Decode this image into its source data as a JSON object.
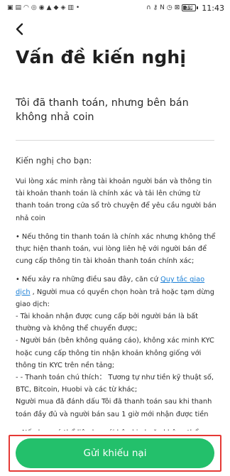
{
  "status_bar": {
    "left_icons": [
      "notification-icon",
      "image-icon",
      "wifi-icon",
      "sync-icon",
      "app-icon",
      "location-icon",
      "bell-icon",
      "app-icon",
      "translate-icon",
      "more-icon"
    ],
    "right_icons": [
      "headphones-icon",
      "key-icon",
      "nfc-icon",
      "alarm-icon",
      "no-sim-icon"
    ],
    "battery": "39",
    "time": "11:43"
  },
  "header": {
    "title": "Vấn đề kiến nghị"
  },
  "case": {
    "title": "Tôi đã thanh toán, nhưng bên bán không nhả coin"
  },
  "suggestion": {
    "heading": "Kiến nghị cho bạn:",
    "p1": "Vui lòng xác minh rằng tài khoản người bán và thông tin tài khoản thanh toán là chính xác và tải lên chứng từ thanh toán trong cửa sổ trò chuyện để yêu cầu người bán nhả coin",
    "p2": "• Nếu thông tin thanh toán là chính xác nhưng không thể thực hiện thanh toán, vui lòng liên hệ với người bán để cung cấp thông tin tài khoản thanh toán chính xác;",
    "p3_before": "• Nếu xảy ra những điều sau đây, căn cứ ",
    "p3_link": "Quy tắc giao dịch",
    "p3_after": " , Người mua có quyền chọn hoàn trả hoặc tạm dừng giao dịch:",
    "p3_line1": " - Tài khoản nhận được cung cấp bởi người bán là bất thường và không thể chuyển được;",
    "p3_line2": " - Người bán (bên không quảng cáo), không xác minh KYC hoặc cung cấp thông tin nhận khoản không giống với thông tin KYC trên nền tảng;",
    "p3_line3": " - - Thanh toán chú thích： Tương tự như tiền kỹ thuật số, BTC, Bitcoin, Huobi và các từ khác;",
    "p3_line4": "  Người mua đã đánh dấu Tôi đã thanh toán sau khi thanh toán đầy đủ và người bán sau 1 giờ mới nhận được tiền",
    "p4": "• Nếu bạn có thể liên lạc với bên kia hoặc không thể"
  },
  "footer": {
    "submit_label": "Gửi khiếu nại"
  },
  "colors": {
    "accent_green": "#23C06B",
    "link_blue": "#1A7FD6",
    "highlight_red": "#E53935"
  }
}
